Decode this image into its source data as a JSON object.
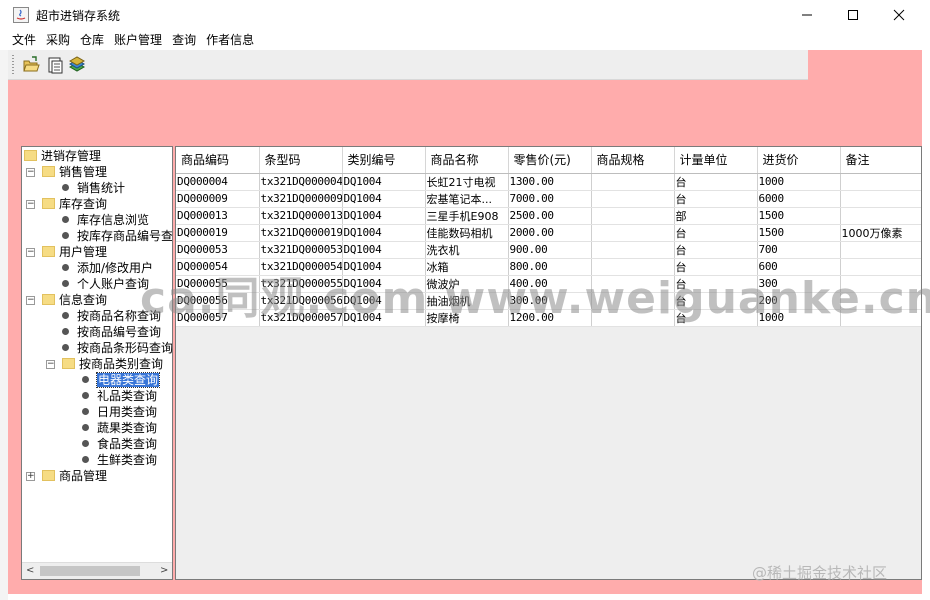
{
  "window": {
    "title": "超市进销存系统"
  },
  "menu": [
    "文件",
    "采购",
    "仓库",
    "账户管理",
    "查询",
    "作者信息"
  ],
  "toolbar": {
    "icons": [
      "open-folder-icon",
      "notepad-icon",
      "books-icon"
    ]
  },
  "tree": [
    {
      "label": "进销存管理",
      "type": "folder",
      "level": 0
    },
    {
      "label": "销售管理",
      "type": "folder",
      "level": 1,
      "expanded": true
    },
    {
      "label": "销售统计",
      "type": "leaf",
      "level": 2
    },
    {
      "label": "库存查询",
      "type": "folder",
      "level": 1,
      "expanded": true
    },
    {
      "label": "库存信息浏览",
      "type": "leaf",
      "level": 2
    },
    {
      "label": "按库存商品编号查",
      "type": "leaf",
      "level": 2
    },
    {
      "label": "用户管理",
      "type": "folder",
      "level": 1,
      "expanded": true
    },
    {
      "label": "添加/修改用户",
      "type": "leaf",
      "level": 2
    },
    {
      "label": "个人账户查询",
      "type": "leaf",
      "level": 2
    },
    {
      "label": "信息查询",
      "type": "folder",
      "level": 1,
      "expanded": true
    },
    {
      "label": "按商品名称查询",
      "type": "leaf",
      "level": 2
    },
    {
      "label": "按商品编号查询",
      "type": "leaf",
      "level": 2
    },
    {
      "label": "按商品条形码查询",
      "type": "leaf",
      "level": 2
    },
    {
      "label": "按商品类别查询",
      "type": "folder",
      "level": 2,
      "expanded": true
    },
    {
      "label": "电器类查询",
      "type": "leaf",
      "level": 3,
      "selected": true
    },
    {
      "label": "礼品类查询",
      "type": "leaf",
      "level": 3
    },
    {
      "label": "日用类查询",
      "type": "leaf",
      "level": 3
    },
    {
      "label": "蔬果类查询",
      "type": "leaf",
      "level": 3
    },
    {
      "label": "食品类查询",
      "type": "leaf",
      "level": 3
    },
    {
      "label": "生鲜类查询",
      "type": "leaf",
      "level": 3
    },
    {
      "label": "商品管理",
      "type": "folder",
      "level": 1,
      "expanded": false
    }
  ],
  "table": {
    "columns": [
      "商品编码",
      "条型码",
      "类别编号",
      "商品名称",
      "零售价(元)",
      "商品规格",
      "计量单位",
      "进货价",
      "备注"
    ],
    "rows": [
      [
        "DQ000004",
        "tx321DQ000004",
        "DQ1004",
        "长虹21寸电视",
        "1300.00",
        "",
        "台",
        "1000",
        ""
      ],
      [
        "DQ000009",
        "tx321DQ000009",
        "DQ1004",
        "宏基笔记本...",
        "7000.00",
        "",
        "台",
        "6000",
        ""
      ],
      [
        "DQ000013",
        "tx321DQ000013",
        "DQ1004",
        "三星手机E908",
        "2500.00",
        "",
        "部",
        "1500",
        ""
      ],
      [
        "DQ000019",
        "tx321DQ000019",
        "DQ1004",
        "佳能数码相机",
        "2000.00",
        "",
        "台",
        "1500",
        "1000万像素"
      ],
      [
        "DQ000053",
        "tx321DQ000053",
        "DQ1004",
        "洗衣机",
        "900.00",
        "",
        "台",
        "700",
        ""
      ],
      [
        "DQ000054",
        "tx321DQ000054",
        "DQ1004",
        "冰箱",
        "800.00",
        "",
        "台",
        "600",
        ""
      ],
      [
        "DQ000055",
        "tx321DQ000055",
        "DQ1004",
        "微波炉",
        "400.00",
        "",
        "台",
        "300",
        ""
      ],
      [
        "DQ000056",
        "tx321DQ000056",
        "DQ1004",
        "抽油烟机",
        "300.00",
        "",
        "台",
        "200",
        ""
      ],
      [
        "DQ000057",
        "tx321DQ000057",
        "DQ1004",
        "按摩椅",
        "1200.00",
        "",
        "台",
        "1000",
        ""
      ]
    ]
  },
  "watermark": "ca.同观.com www.weiguanke.cn",
  "credit": "@稀土掘金技术社区"
}
